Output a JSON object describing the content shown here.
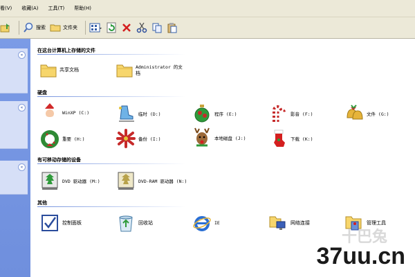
{
  "menu": [
    "看(V)",
    "收藏(A)",
    "工具(T)",
    "帮助(H)"
  ],
  "toolbar": {
    "search": "搜索",
    "folders": "文件夹"
  },
  "sections": {
    "stored": "在这台计算机上存储的文件",
    "drives": "硬盘",
    "removable": "有可移动存储的设备",
    "other": "其他"
  },
  "stored_items": [
    "共享文档",
    "Administrator 的文",
    "档"
  ],
  "drives": [
    "WinXP (C:)",
    "临时 (D:)",
    "程序 (E:)",
    "影音 (F:)",
    "文件 (G:)",
    "重要 (H:)",
    "备份 (I:)",
    "本地磁盘 (J:)",
    "下载 (K:)"
  ],
  "removable": [
    "DVD 驱动器 (M:)",
    "DVD-RAM 驱动器 (N:)"
  ],
  "other": [
    "控制面板",
    "回收站",
    "IE",
    "网络连接",
    "管理工具"
  ],
  "watermark": {
    "main": "37uu.cn",
    "faint": "十巴兔"
  }
}
